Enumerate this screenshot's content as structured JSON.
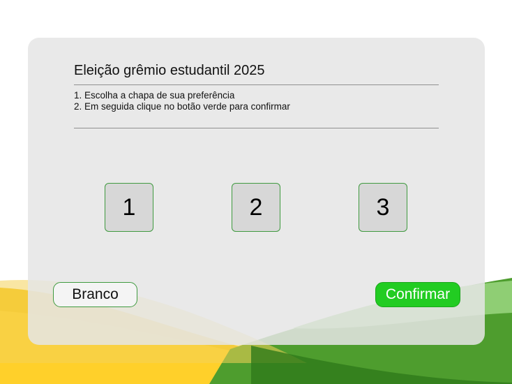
{
  "election": {
    "title": "Eleição grêmio estudantil 2025",
    "instructions": [
      "1. Escolha a chapa de sua preferência",
      "2. Em seguida clique no botão verde para confirmar"
    ]
  },
  "choices": [
    "1",
    "2",
    "3"
  ],
  "actions": {
    "blank_label": "Branco",
    "confirm_label": "Confirmar"
  },
  "colors": {
    "confirm_green": "#22cc22",
    "accent_border": "#3f9a3f",
    "panel_gray": "#e5e5e5",
    "wave_yellow": "#f7c51a",
    "wave_green": "#4e9d2e"
  }
}
